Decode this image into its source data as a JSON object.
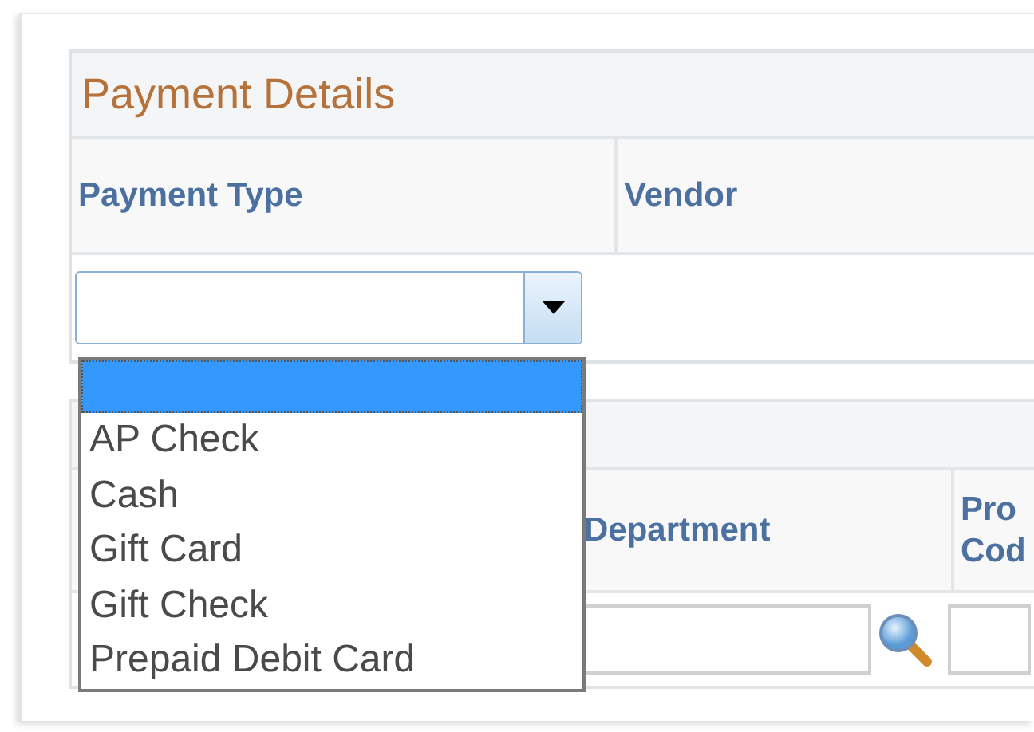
{
  "payment_details": {
    "title": "Payment Details",
    "columns": [
      {
        "label": "Payment Type"
      },
      {
        "label": "Vendor"
      }
    ],
    "payment_type": {
      "expanded": true,
      "options": [
        {
          "selected": true
        },
        {
          "label": "AP Check",
          "selected": false
        },
        {
          "label": "Cash",
          "selected": false
        },
        {
          "label": "Gift Card",
          "selected": false
        },
        {
          "label": "Gift Check",
          "selected": false
        },
        {
          "label": "Prepaid Debit Card",
          "selected": false
        }
      ]
    }
  },
  "second_grid": {
    "columns": [
      {
        "label": "Department"
      },
      {
        "lines": [
          "Pro",
          "Cod"
        ]
      }
    ]
  }
}
